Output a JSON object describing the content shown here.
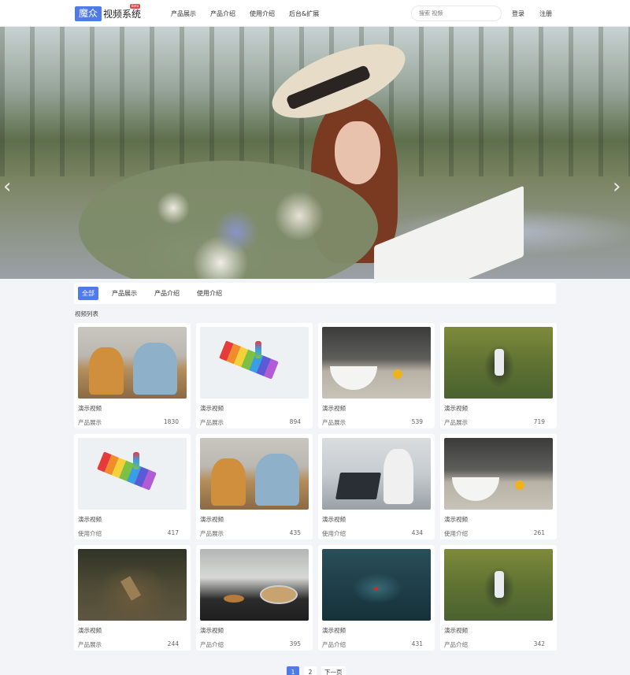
{
  "header": {
    "logo_box": "魔众",
    "logo_text": "视频系统",
    "logo_badge": "Beta",
    "nav": [
      "产品展示",
      "产品介绍",
      "使用介绍",
      "后台&扩展"
    ],
    "search_placeholder": "搜索 视频",
    "login": "登录",
    "register": "注册"
  },
  "banner": {
    "prev_icon": "‹",
    "next_icon": "›"
  },
  "filter": {
    "tabs": [
      "全部",
      "产品展示",
      "产品介绍",
      "使用介绍"
    ],
    "active_index": 0
  },
  "section_title": "视频列表",
  "videos": [
    {
      "title": "演示视频",
      "category": "产品展示",
      "views": "1830"
    },
    {
      "title": "演示视频",
      "category": "产品展示",
      "views": "894"
    },
    {
      "title": "演示视频",
      "category": "产品展示",
      "views": "539"
    },
    {
      "title": "演示视频",
      "category": "产品展示",
      "views": "719"
    },
    {
      "title": "演示视频",
      "category": "使用介绍",
      "views": "417"
    },
    {
      "title": "演示视频",
      "category": "产品展示",
      "views": "435"
    },
    {
      "title": "演示视频",
      "category": "使用介绍",
      "views": "434"
    },
    {
      "title": "演示视频",
      "category": "使用介绍",
      "views": "261"
    },
    {
      "title": "演示视频",
      "category": "产品展示",
      "views": "244"
    },
    {
      "title": "演示视频",
      "category": "产品介绍",
      "views": "395"
    },
    {
      "title": "演示视频",
      "category": "产品介绍",
      "views": "431"
    },
    {
      "title": "演示视频",
      "category": "产品介绍",
      "views": "342"
    }
  ],
  "pagination": {
    "pages": [
      "1",
      "2"
    ],
    "current": "1",
    "next_label": "下一页"
  },
  "colors": {
    "accent": "#4f7be8",
    "badge": "#e84545",
    "page_bg": "#f3f4f7"
  }
}
